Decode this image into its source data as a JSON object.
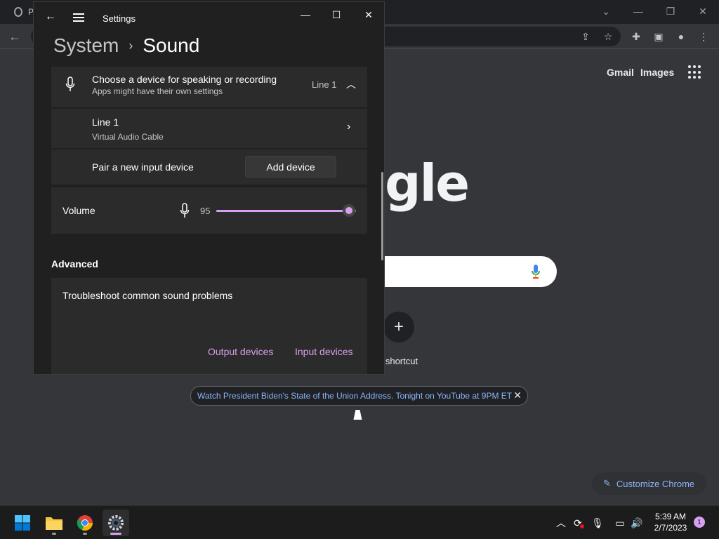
{
  "chrome": {
    "tab_title": "P",
    "gmail": "Gmail",
    "images": "Images",
    "logo_fragment": "gle",
    "shortcut_label": "d shortcut",
    "promo_text": "Watch President Biden's State of the Union Address. Tonight on YouTube at 9PM ET",
    "customize_label": "Customize Chrome"
  },
  "settings": {
    "window_title": "Settings",
    "breadcrumb": {
      "parent": "System",
      "separator": "›",
      "current": "Sound"
    },
    "input_selector": {
      "title": "Choose a device for speaking or recording",
      "subtitle": "Apps might have their own settings",
      "selected": "Line 1"
    },
    "device": {
      "name": "Line 1",
      "description": "Virtual Audio Cable"
    },
    "pair": {
      "label": "Pair a new input device",
      "button": "Add device"
    },
    "volume": {
      "label": "Volume",
      "value": "95",
      "level": 0.95
    },
    "advanced": {
      "heading": "Advanced",
      "troubleshoot": "Troubleshoot common sound problems",
      "output_link": "Output devices",
      "input_link": "Input devices"
    }
  },
  "taskbar": {
    "apps": [
      "start-icon",
      "file-explorer-icon",
      "chrome-icon",
      "settings-icon"
    ],
    "time": "5:39 AM",
    "date": "2/7/2023",
    "notification_count": "1"
  },
  "colors": {
    "accent": "#d7a0f0",
    "link": "#8ab4f8",
    "settings_bg": "#202020",
    "card_bg": "#2b2b2b"
  }
}
